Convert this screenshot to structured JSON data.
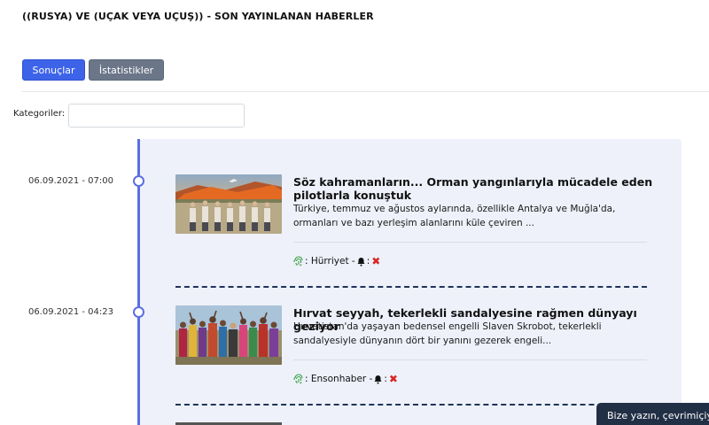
{
  "header": {
    "title": "((RUSYA) VE (UÇAK VEYA UÇUŞ)) - SON YAYINLANAN HABERLER"
  },
  "tabs": {
    "results": "Sonuçlar",
    "stats": "İstatistikler"
  },
  "filters": {
    "category_label": "Kategoriler:",
    "category_value": ""
  },
  "news": [
    {
      "date": "06.09.2021 - 07:00",
      "title": "Söz kahramanların... Orman yangınlarıyla mücadele eden pilotlarla konuştuk",
      "summary": "Türkiye, temmuz ve ağustos aylarında, özellikle Antalya ve Muğla'da, ormanları ve bazı yerleşim alanlarını küle çeviren ...",
      "source_prefix": ": Hürriyet - ",
      "source_suffix": ":"
    },
    {
      "date": "06.09.2021 - 04:23",
      "title": "Hırvat seyyah, tekerlekli sandalyesine rağmen dünyayı geziyor",
      "summary": "Hırvatistan'da yaşayan bedensel engelli Slaven Skrobot, tekerlekli sandalyesiyle dünyanın dört bir yanını gezerek engeli...",
      "source_prefix": ": Ensonhaber - ",
      "source_suffix": ":"
    }
  ],
  "icons": {
    "source": "fingerprint-icon",
    "alert": "bell-icon",
    "status": "x-icon"
  },
  "chat": {
    "label": "Bize yazın, çevrimiçiyiz"
  },
  "colors": {
    "primary": "#3d63e9",
    "secondary": "#6b7689",
    "timeline": "#5b6fe0",
    "panel": "#eef1fa",
    "danger": "#d92626",
    "chat": "#223046"
  }
}
